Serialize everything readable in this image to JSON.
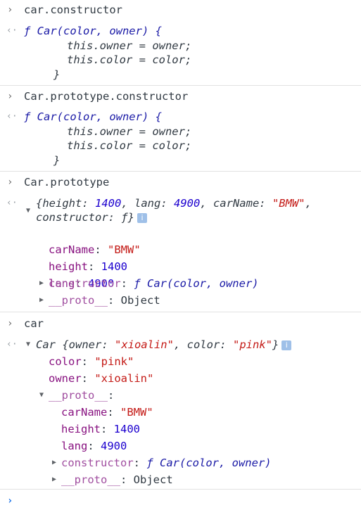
{
  "entries": [
    {
      "input": "car.constructor",
      "result": [
        "ƒ Car(color, owner) {",
        "this.owner = owner;",
        "this.color = color;",
        "}"
      ]
    },
    {
      "input": "Car.prototype.constructor",
      "result": [
        "ƒ Car(color, owner) {",
        "this.owner = owner;",
        "this.color = color;",
        "}"
      ]
    },
    {
      "input": "Car.prototype",
      "summary": {
        "line1": "{height: 1400, lang: 4900, carName: \"BMW\",",
        "line2": "constructor: ƒ}"
      },
      "props": [
        {
          "key": "carName",
          "val": "\"BMW\""
        },
        {
          "key": "height",
          "val": "1400"
        },
        {
          "key": "lang",
          "val": "4900"
        },
        {
          "key": "constructor",
          "val": "ƒ Car(color, owner)"
        },
        {
          "key": "__proto__",
          "val": "Object"
        }
      ]
    },
    {
      "input": "car",
      "summary": "Car {owner: \"xioalin\", color: \"pink\"}",
      "props": [
        {
          "key": "color",
          "val": "\"pink\""
        },
        {
          "key": "owner",
          "val": "\"xioalin\""
        },
        {
          "key": "__proto__",
          "val": ""
        }
      ],
      "proto_props": [
        {
          "key": "carName",
          "val": "\"BMW\""
        },
        {
          "key": "height",
          "val": "1400"
        },
        {
          "key": "lang",
          "val": "4900"
        },
        {
          "key": "constructor",
          "val": "ƒ Car(color, owner)"
        },
        {
          "key": "__proto__",
          "val": "Object"
        }
      ]
    }
  ],
  "icons": {
    "input_prompt": "chevron-right-icon",
    "result_marker": "return-arrow-icon",
    "info": "info-icon"
  },
  "glyphs": {
    "input_prompt": "›",
    "result_marker": "‹·",
    "expanded": "▼",
    "collapsed": "▶",
    "info": "i"
  }
}
